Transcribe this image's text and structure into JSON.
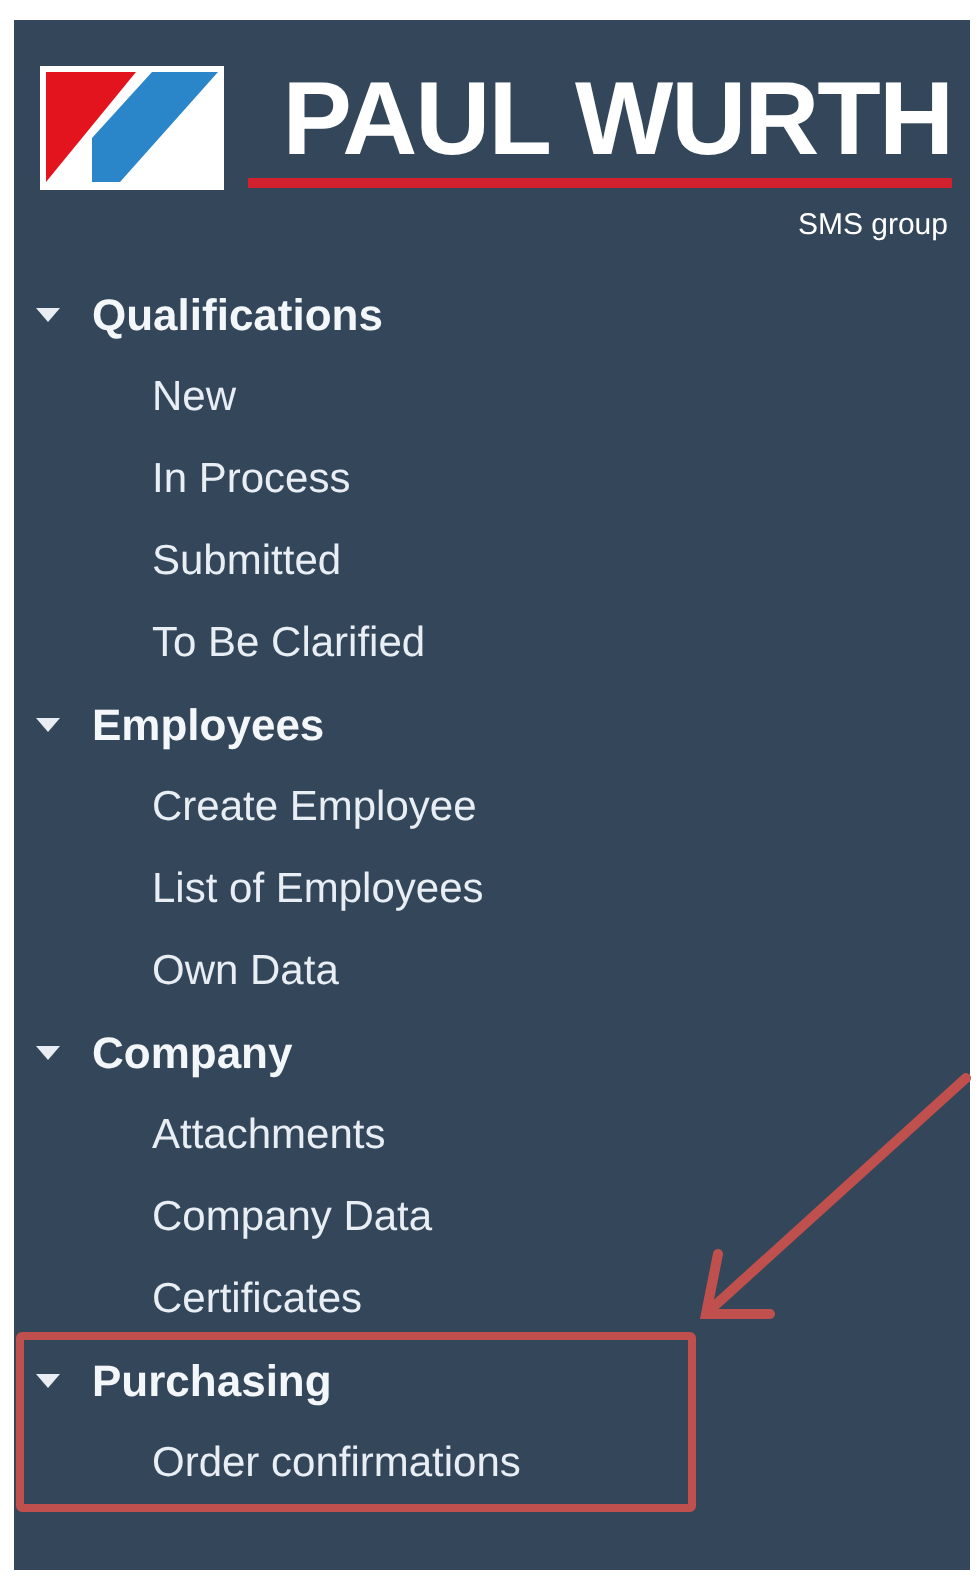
{
  "logo": {
    "name": "PAUL WURTH",
    "tagline": "SMS group"
  },
  "navigation": [
    {
      "label": "Qualifications",
      "expanded": true,
      "highlighted": false,
      "children": [
        {
          "label": "New"
        },
        {
          "label": "In Process"
        },
        {
          "label": "Submitted"
        },
        {
          "label": "To Be Clarified"
        }
      ]
    },
    {
      "label": "Employees",
      "expanded": true,
      "highlighted": false,
      "children": [
        {
          "label": "Create Employee"
        },
        {
          "label": "List of Employees"
        },
        {
          "label": "Own Data"
        }
      ]
    },
    {
      "label": "Company",
      "expanded": true,
      "highlighted": false,
      "children": [
        {
          "label": "Attachments"
        },
        {
          "label": "Company Data"
        },
        {
          "label": "Certificates"
        }
      ]
    },
    {
      "label": "Purchasing",
      "expanded": true,
      "highlighted": true,
      "children": [
        {
          "label": "Order confirmations"
        }
      ]
    }
  ]
}
